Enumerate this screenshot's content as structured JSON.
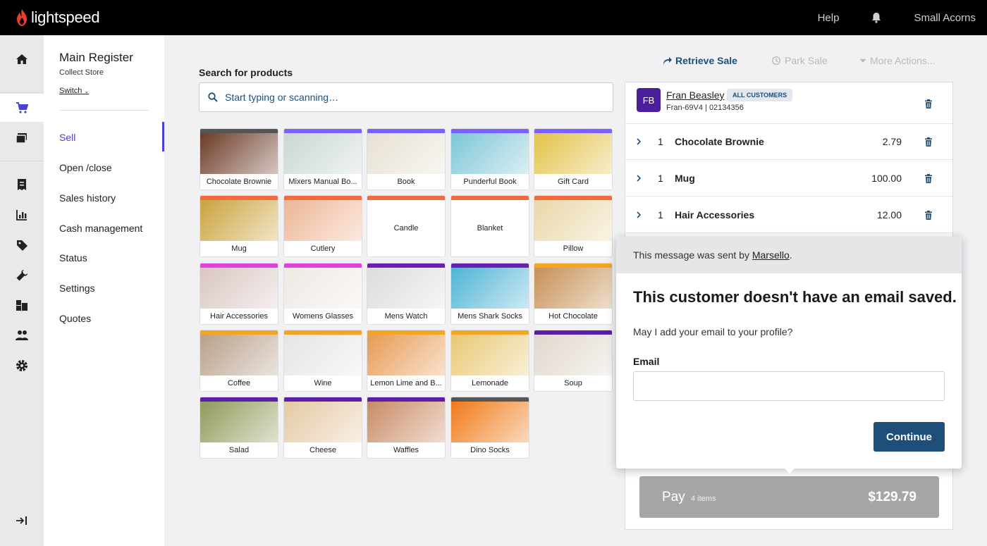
{
  "app": {
    "logo_text": "lightspeed",
    "brand_color": "#e93d2f"
  },
  "topbar": {
    "help": "Help",
    "store": "Small Acorns"
  },
  "rail": {
    "icons": [
      "home-icon",
      "cart-icon",
      "register-icon",
      "sales-icon",
      "reports-icon",
      "tag-icon",
      "wrench-icon",
      "inventory-icon",
      "customers-icon",
      "settings-icon",
      "collapse-icon"
    ],
    "active": "cart-icon"
  },
  "nav": {
    "title": "Main Register",
    "store": "Collect Store",
    "switch": "Switch",
    "items": [
      {
        "label": "Sell",
        "active": true
      },
      {
        "label": "Open /close"
      },
      {
        "label": "Sales history"
      },
      {
        "label": "Cash management"
      },
      {
        "label": "Status"
      },
      {
        "label": "Settings"
      },
      {
        "label": "Quotes"
      }
    ]
  },
  "search": {
    "label": "Search for products",
    "placeholder": "Start typing or scanning…"
  },
  "tiles": [
    {
      "name": "Chocolate Brownie",
      "color": "#555555",
      "art": "#6b3a26"
    },
    {
      "name": "Mixers Manual Bo...",
      "color": "#7b61ff",
      "art": "#c9d7d3"
    },
    {
      "name": "Book",
      "color": "#7b61ff",
      "art": "#e7e0d3"
    },
    {
      "name": "Punderful Book",
      "color": "#7b61ff",
      "art": "#7dc6d6"
    },
    {
      "name": "Gift Card",
      "color": "#7b61ff",
      "art": "#e3c34a"
    },
    {
      "name": "Mug",
      "color": "#f26a3d",
      "art": "#c9a33c"
    },
    {
      "name": "Cutlery",
      "color": "#f26a3d",
      "art": "#eeb595"
    },
    {
      "name": "Candle",
      "color": "#f26a3d",
      "art": ""
    },
    {
      "name": "Blanket",
      "color": "#f26a3d",
      "art": ""
    },
    {
      "name": "Pillow",
      "color": "#f26a3d",
      "art": "#e9d7a7"
    },
    {
      "name": "Hair Accessories",
      "color": "#e040e0",
      "art": "#d9c6c2"
    },
    {
      "name": "Womens Glasses",
      "color": "#e040e0",
      "art": "#efe8e3"
    },
    {
      "name": "Mens Watch",
      "color": "#6a1fb3",
      "art": "#dcdcdc"
    },
    {
      "name": "Mens Shark Socks",
      "color": "#6a1fb3",
      "art": "#4fb3d6"
    },
    {
      "name": "Hot Chocolate",
      "color": "#f2a622",
      "art": "#c78f55"
    },
    {
      "name": "Coffee",
      "color": "#f2a622",
      "art": "#b7a08a"
    },
    {
      "name": "Wine",
      "color": "#f2a622",
      "art": "#e5e5e5"
    },
    {
      "name": "Lemon Lime and B...",
      "color": "#f2a622",
      "art": "#e79a54"
    },
    {
      "name": "Lemonade",
      "color": "#f2a622",
      "art": "#e8c874"
    },
    {
      "name": "Soup",
      "color": "#5b1fa6",
      "art": "#e1d7cd"
    },
    {
      "name": "Salad",
      "color": "#5b1fa6",
      "art": "#8f9a5a"
    },
    {
      "name": "Cheese",
      "color": "#5b1fa6",
      "art": "#e4c9a4"
    },
    {
      "name": "Waffles",
      "color": "#5b1fa6",
      "art": "#c88b64"
    },
    {
      "name": "Dino Socks",
      "color": "#555555",
      "art": "#f07a18"
    }
  ],
  "actions": {
    "retrieve": "Retrieve Sale",
    "park": "Park Sale",
    "more": "More Actions..."
  },
  "customer": {
    "initials": "FB",
    "name": "Fran Beasley",
    "badge": "ALL CUSTOMERS",
    "id": "Fran-69V4 | 02134356",
    "avatar_color": "#4c1e9c"
  },
  "lines": [
    {
      "qty": "1",
      "item": "Chocolate Brownie",
      "price": "2.79"
    },
    {
      "qty": "1",
      "item": "Mug",
      "price": "100.00"
    },
    {
      "qty": "1",
      "item": "Hair Accessories",
      "price": "12.00"
    }
  ],
  "pay": {
    "label": "Pay",
    "items": "4 items",
    "total": "$129.79"
  },
  "popup": {
    "sent_prefix": "This message was sent by ",
    "sender": "Marsello",
    "sent_suffix": ".",
    "title": "This customer doesn't have an email saved.",
    "question": "May I add your email to your profile?",
    "email_label": "Email",
    "email_value": "",
    "continue": "Continue"
  }
}
